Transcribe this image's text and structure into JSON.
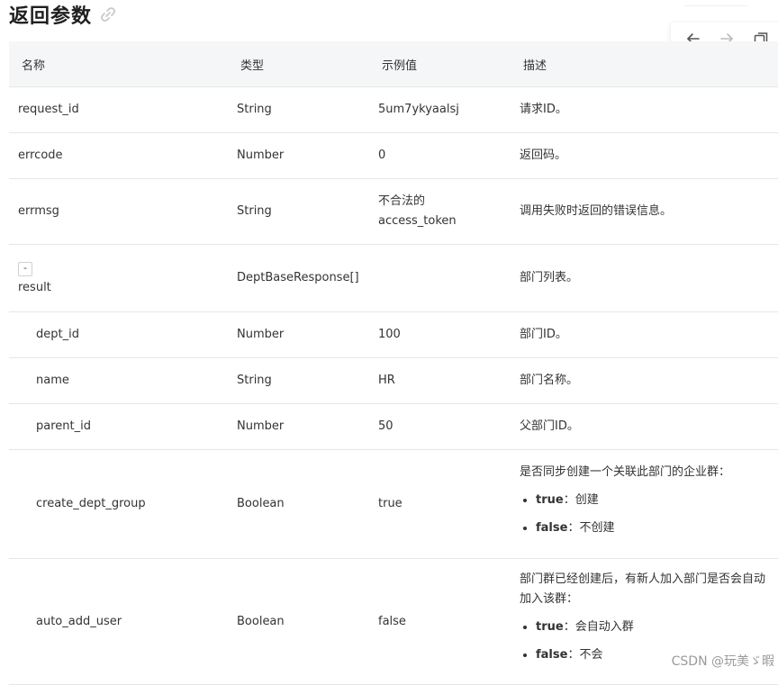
{
  "page": {
    "title": "返回参数",
    "watermark": "CSDN @玩美ゞ暇"
  },
  "nav": {
    "back_icon": "arrow-left-icon",
    "forward_icon": "arrow-right-icon",
    "window_icon": "window-restore-icon"
  },
  "table": {
    "headers": [
      "名称",
      "类型",
      "示例值",
      "描述"
    ],
    "rows": [
      {
        "name": "request_id",
        "type": "String",
        "example": "5um7ykyaalsj",
        "desc": "请求ID。"
      },
      {
        "name": "errcode",
        "type": "Number",
        "example": "0",
        "desc": "返回码。"
      },
      {
        "name": "errmsg",
        "type": "String",
        "example_line1": "不合法的",
        "example_line2": "access_token",
        "desc": "调用失败时返回的错误信息。"
      },
      {
        "toggle": "-",
        "name": "result",
        "type": "DeptBaseResponse[]",
        "example": "",
        "desc": "部门列表。"
      },
      {
        "name": "dept_id",
        "type": "Number",
        "example": "100",
        "desc": "部门ID。"
      },
      {
        "name": "name",
        "type": "String",
        "example": "HR",
        "desc": "部门名称。"
      },
      {
        "name": "parent_id",
        "type": "Number",
        "example": "50",
        "desc": "父部门ID。"
      },
      {
        "name": "create_dept_group",
        "type": "Boolean",
        "example": "true",
        "desc": "是否同步创建一个关联此部门的企业群：",
        "opts": [
          {
            "k": "true",
            "v": "：创建"
          },
          {
            "k": "false",
            "v": "：不创建"
          }
        ]
      },
      {
        "name": "auto_add_user",
        "type": "Boolean",
        "example": "false",
        "desc": "部门群已经创建后，有新人加入部门是否会自动加入该群：",
        "opts": [
          {
            "k": "true",
            "v": "：会自动入群"
          },
          {
            "k": "false",
            "v": "：不会"
          }
        ]
      }
    ]
  }
}
